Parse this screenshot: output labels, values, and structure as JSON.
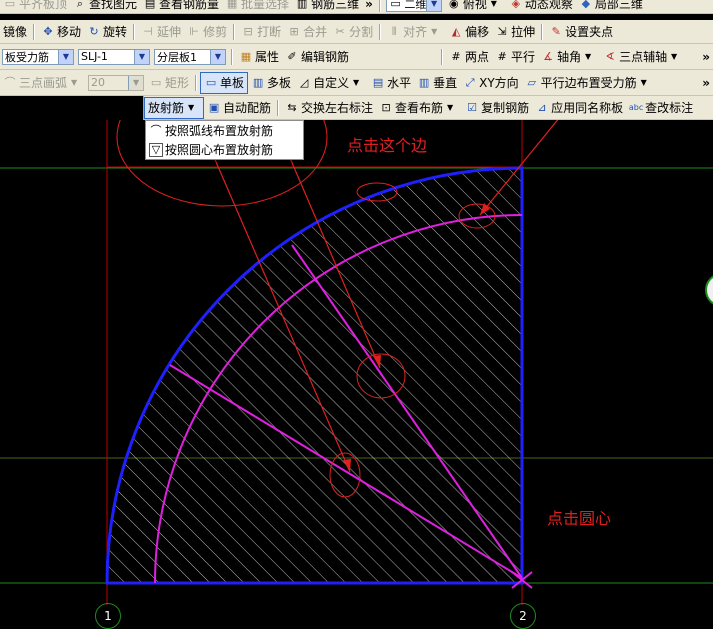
{
  "toolbar1": {
    "items": [
      {
        "label": "平齐板顶",
        "icon": "align-top-icon",
        "disabled": true
      },
      {
        "label": "查找图元",
        "icon": "find-element-icon"
      },
      {
        "label": "查看钢筋量",
        "icon": "view-rebar-qty-icon"
      },
      {
        "label": "批量选择",
        "icon": "batch-select-icon",
        "disabled": true
      },
      {
        "label": "钢筋三维",
        "icon": "rebar-3d-icon"
      }
    ],
    "view_combo": "二维",
    "view_mode": "俯视",
    "dynamic_view": "动态观察",
    "local_3d": "局部三维"
  },
  "toolbar2": {
    "items": [
      {
        "label": "镜像",
        "icon": "mirror-icon"
      },
      {
        "label": "移动",
        "icon": "move-icon"
      },
      {
        "label": "旋转",
        "icon": "rotate-icon"
      },
      {
        "label": "延伸",
        "icon": "extend-icon",
        "disabled": true
      },
      {
        "label": "修剪",
        "icon": "trim-icon",
        "disabled": true
      },
      {
        "label": "打断",
        "icon": "break-icon",
        "disabled": true
      },
      {
        "label": "合并",
        "icon": "merge-icon",
        "disabled": true
      },
      {
        "label": "分割",
        "icon": "split-icon",
        "disabled": true
      },
      {
        "label": "对齐",
        "icon": "align-icon",
        "disabled": true
      },
      {
        "label": "偏移",
        "icon": "offset-icon"
      },
      {
        "label": "拉伸",
        "icon": "stretch-icon"
      },
      {
        "label": "设置夹点",
        "icon": "grip-icon"
      }
    ]
  },
  "toolbar3": {
    "combo_type": "板受力筋",
    "combo_name": "SLJ-1",
    "combo_layer": "分层板1",
    "property": "属性",
    "edit_rebar": "编辑钢筋",
    "two_points": "两点",
    "parallel": "平行",
    "axis_angle": "轴角",
    "three_point_aux": "三点辅轴"
  },
  "toolbar4": {
    "three_point_arc": "三点画弧",
    "arc_value": "20",
    "rectangle": "矩形",
    "single_board": "单板",
    "multi_board": "多板",
    "custom": "自定义",
    "horizontal": "水平",
    "vertical": "垂直",
    "xy_direction": "XY方向",
    "parallel_edge": "平行边布置受力筋"
  },
  "toolbar5": {
    "radial_bar": "放射筋",
    "auto_rebar": "自动配筋",
    "swap_label": "交换左右标注",
    "view_layout": "查看布筋",
    "copy_rebar": "复制钢筋",
    "apply_same": "应用同名称板",
    "view_mark": "查改标注"
  },
  "dropdown": {
    "items": [
      "按照弧线布置放射筋",
      "按照圆心布置放射筋"
    ]
  },
  "annotations": {
    "click_edge": "点击这个边",
    "click_center": "点击圆心"
  },
  "axis_labels": [
    "1",
    "2"
  ],
  "colors": {
    "canvas": "#000000",
    "board_edge": "#2020FF",
    "rebar": "#E020E0",
    "annotation": "#E02020",
    "grid": "#C00000",
    "hatch": "#E8E8E8"
  }
}
